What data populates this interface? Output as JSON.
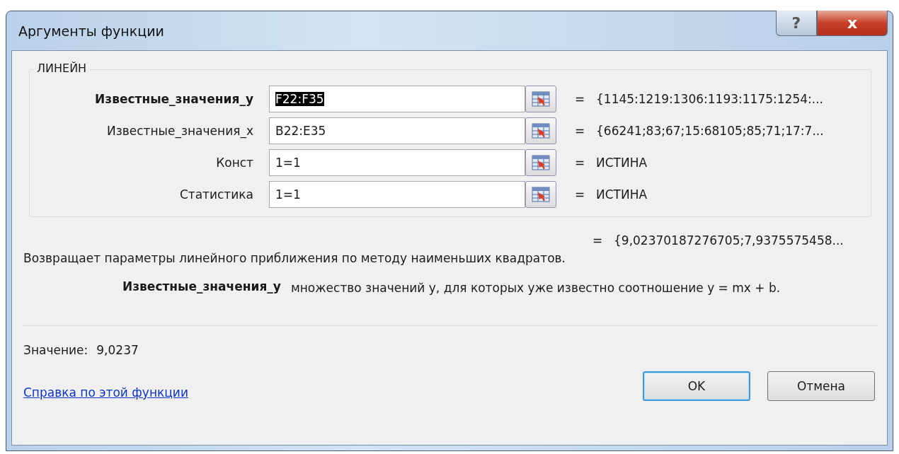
{
  "window": {
    "title": "Аргументы функции"
  },
  "function_name": "ЛИНЕЙН",
  "arguments": [
    {
      "label": "Известные_значения_y",
      "value": "F22:F35",
      "result": "{1145:1219:1306:1193:1175:1254:...",
      "selected": true
    },
    {
      "label": "Известные_значения_x",
      "value": "B22:E35",
      "result": "{66241;83;67;15:68105;85;71;17:7...",
      "selected": false
    },
    {
      "label": "Конст",
      "value": "1=1",
      "result": "ИСТИНА",
      "selected": false
    },
    {
      "label": "Статистика",
      "value": "1=1",
      "result": "ИСТИНА",
      "selected": false
    }
  ],
  "equals": "=",
  "formula_result": "{9,02370187276705;7,9375575458...",
  "description": "Возвращает параметры линейного приближения по методу наименьших квадратов.",
  "argument_help": {
    "name": "Известные_значения_y",
    "text": "множество значений y, для которых уже известно соотношение y = mx + b."
  },
  "value_label": "Значение:",
  "value": "9,0237",
  "help_link": "Справка по этой функции",
  "buttons": [
    {
      "label": "OK",
      "default": true
    },
    {
      "label": "Отмена",
      "default": false
    }
  ],
  "title_buttons": [
    {
      "kind": "help",
      "glyph": "?"
    },
    {
      "kind": "close",
      "glyph": "x"
    }
  ]
}
